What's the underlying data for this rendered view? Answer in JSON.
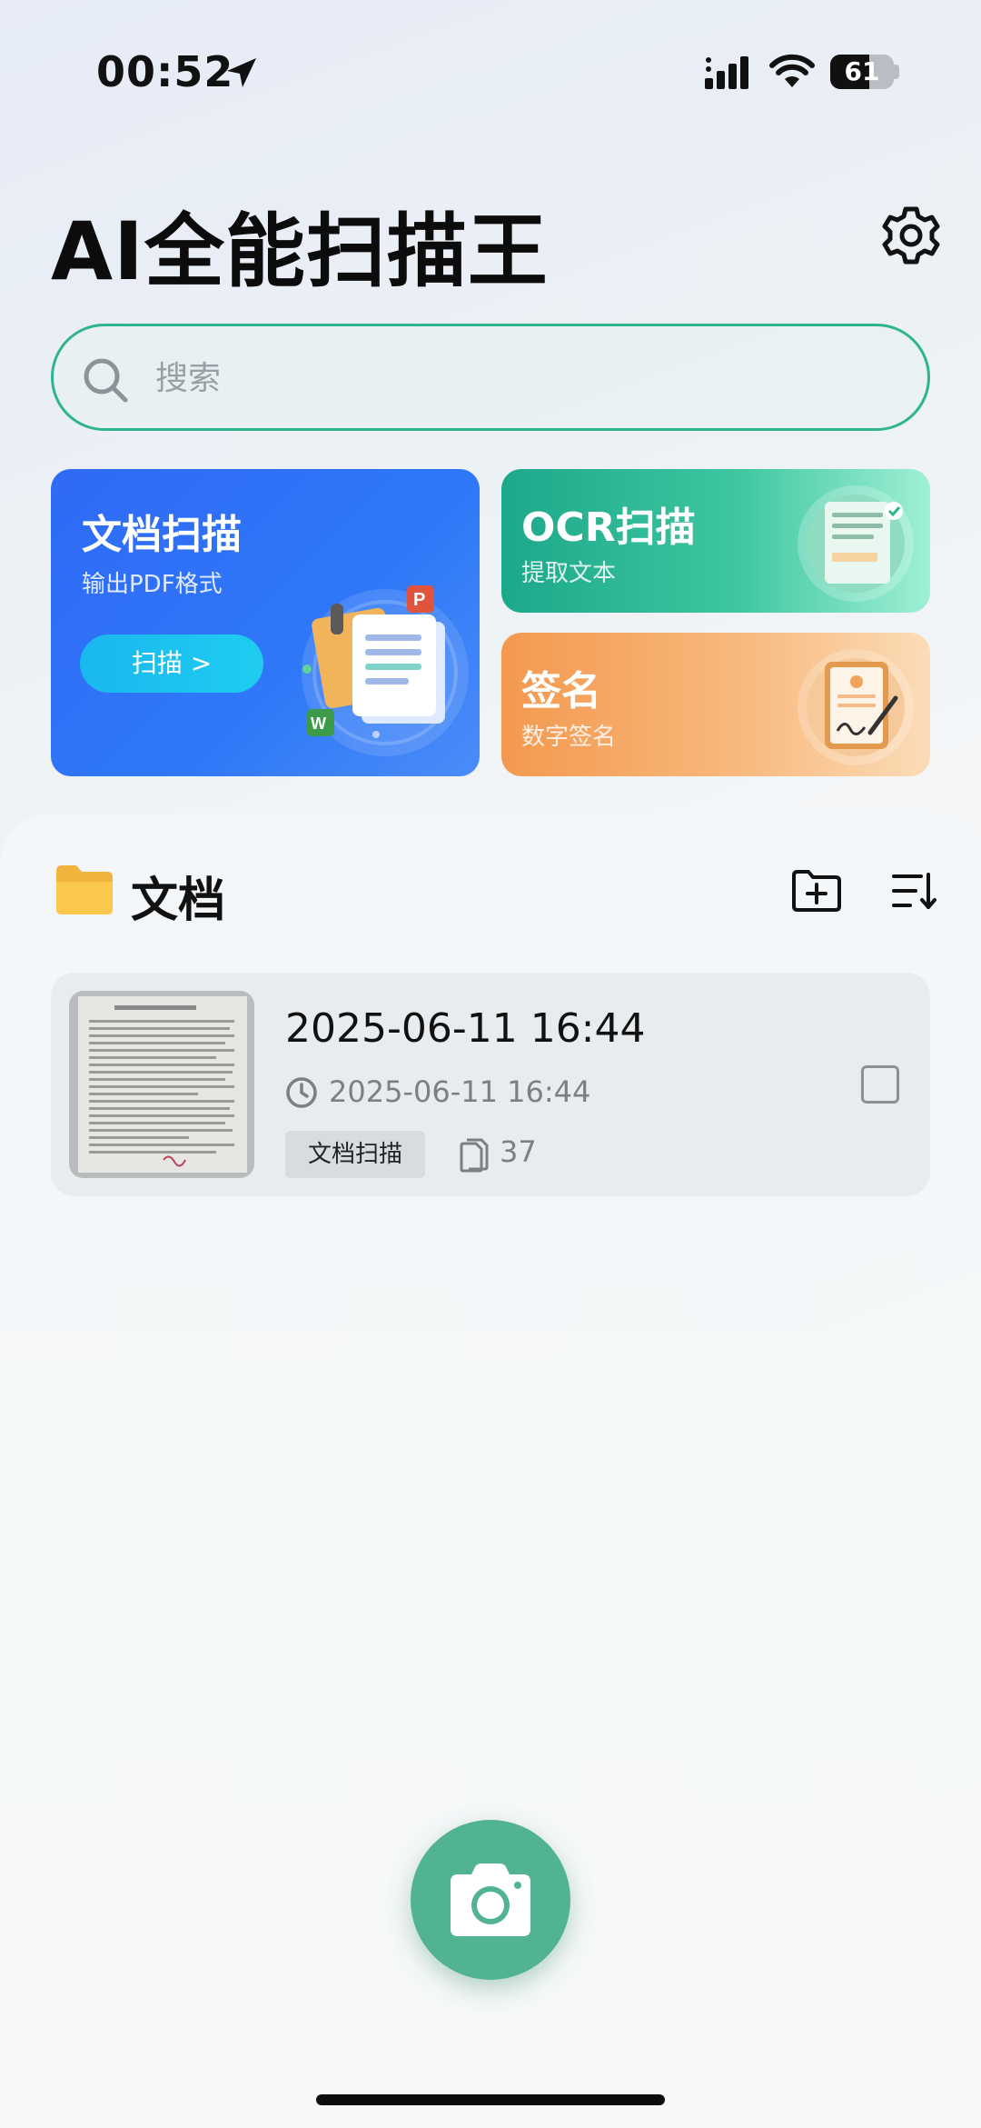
{
  "status_bar": {
    "time": "00:52",
    "battery_level": "61",
    "battery_fraction": 0.61
  },
  "header": {
    "title": "AI全能扫描王"
  },
  "search": {
    "placeholder": "搜索"
  },
  "tools": {
    "doc_scan": {
      "title": "文档扫描",
      "subtitle": "输出PDF格式",
      "button_label": "扫描 >"
    },
    "ocr_scan": {
      "title": "OCR扫描",
      "subtitle": "提取文本"
    },
    "signature": {
      "title": "签名",
      "subtitle": "数字签名"
    }
  },
  "documents": {
    "section_title": "文档",
    "items": [
      {
        "title": "2025-06-11 16:44",
        "time": "2025-06-11 16:44",
        "tag": "文档扫描",
        "pages": "37"
      }
    ]
  },
  "colors": {
    "accent_green": "#51b393",
    "search_border": "#2fb48e",
    "doc_card_blue": "#2f6af5",
    "ocr_card_green": "#1ca88a",
    "sign_card_orange": "#f3994f"
  },
  "icons": [
    "location-arrow-icon",
    "signal-icon",
    "wifi-icon",
    "battery-icon",
    "gear-icon",
    "search-icon",
    "folder-icon",
    "folder-plus-icon",
    "sort-icon",
    "clock-icon",
    "pages-icon",
    "camera-icon"
  ]
}
